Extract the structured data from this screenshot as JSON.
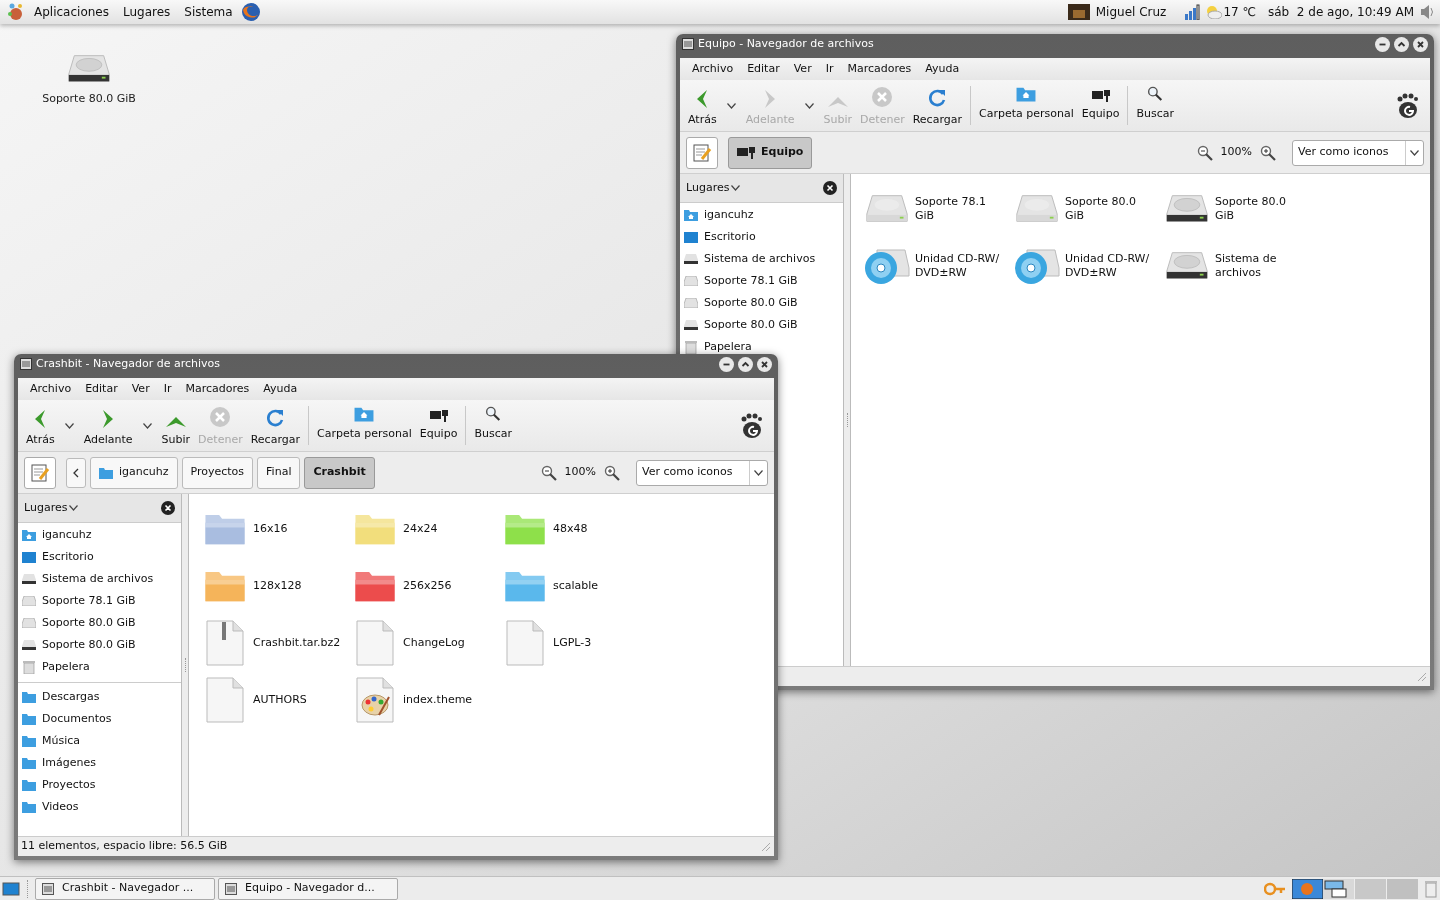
{
  "top_panel": {
    "menus": [
      "Aplicaciones",
      "Lugares",
      "Sistema"
    ],
    "user": "Miguel Cruz",
    "weather": "17 ℃",
    "clock": "sáb  2 de ago, 10:49 AM"
  },
  "desktop_icons": [
    {
      "label": "Soporte 80.0 GiB",
      "kind": "drive-dark"
    }
  ],
  "windows": [
    {
      "title": "Equipo - Navegador de archivos",
      "menus": [
        "Archivo",
        "Editar",
        "Ver",
        "Ir",
        "Marcadores",
        "Ayuda"
      ],
      "toolbar": [
        [
          {
            "label": "Atrás",
            "kind": "back",
            "disabled": false,
            "menu": true
          },
          {
            "label": "Adelante",
            "kind": "forward",
            "disabled": true,
            "menu": true
          },
          {
            "label": "Subir",
            "kind": "up",
            "disabled": true,
            "menu": false
          },
          {
            "label": "Detener",
            "kind": "stop",
            "disabled": true,
            "menu": false
          },
          {
            "label": "Recargar",
            "kind": "reload",
            "disabled": false,
            "menu": false
          }
        ],
        [
          {
            "label": "Carpeta personal",
            "kind": "home",
            "disabled": false,
            "menu": false
          },
          {
            "label": "Equipo",
            "kind": "computer",
            "disabled": false,
            "menu": false
          }
        ],
        [
          {
            "label": "Buscar",
            "kind": "search",
            "disabled": false,
            "menu": false
          }
        ]
      ],
      "location": {
        "scroll_button": false,
        "path": [
          {
            "label": "Equipo",
            "kind": "computer",
            "selected": true
          }
        ]
      },
      "zoom": "100%",
      "view": "Ver como iconos",
      "sidebar": {
        "title": "Lugares",
        "groups": [
          [
            {
              "label": "igancuhz",
              "kind": "home"
            },
            {
              "label": "Escritorio",
              "kind": "desktop"
            },
            {
              "label": "Sistema de archivos",
              "kind": "drive-dark"
            },
            {
              "label": "Soporte 78.1 GiB",
              "kind": "drive"
            },
            {
              "label": "Soporte 80.0 GiB",
              "kind": "drive"
            },
            {
              "label": "Soporte 80.0 GiB",
              "kind": "drive-dark"
            },
            {
              "label": "Papelera",
              "kind": "trash"
            }
          ]
        ]
      },
      "items": [
        {
          "label": "Soporte 78.1 GiB",
          "kind": "drive"
        },
        {
          "label": "Soporte 80.0 GiB",
          "kind": "drive"
        },
        {
          "label": "Soporte 80.0 GiB",
          "kind": "drive-dark"
        },
        {
          "label": "Unidad CD-RW/DVD±RW",
          "kind": "optical"
        },
        {
          "label": "Unidad CD-RW/DVD±RW",
          "kind": "optical"
        },
        {
          "label": "Sistema de archivos",
          "kind": "drive-dark"
        }
      ]
    },
    {
      "title": "Crashbit - Navegador de archivos",
      "menus": [
        "Archivo",
        "Editar",
        "Ver",
        "Ir",
        "Marcadores",
        "Ayuda"
      ],
      "toolbar": [
        [
          {
            "label": "Atrás",
            "kind": "back",
            "disabled": false,
            "menu": true
          },
          {
            "label": "Adelante",
            "kind": "forward",
            "disabled": false,
            "menu": true
          },
          {
            "label": "Subir",
            "kind": "up",
            "disabled": false,
            "menu": false
          },
          {
            "label": "Detener",
            "kind": "stop",
            "disabled": true,
            "menu": false
          },
          {
            "label": "Recargar",
            "kind": "reload",
            "disabled": false,
            "menu": false
          }
        ],
        [
          {
            "label": "Carpeta personal",
            "kind": "home",
            "disabled": false,
            "menu": false
          },
          {
            "label": "Equipo",
            "kind": "computer",
            "disabled": false,
            "menu": false
          }
        ],
        [
          {
            "label": "Buscar",
            "kind": "search",
            "disabled": false,
            "menu": false
          }
        ]
      ],
      "location": {
        "scroll_button": true,
        "path": [
          {
            "label": "igancuhz",
            "kind": "folder",
            "selected": false
          },
          {
            "label": "Proyectos",
            "kind": "text",
            "selected": false
          },
          {
            "label": "Final",
            "kind": "text",
            "selected": false
          },
          {
            "label": "Crashbit",
            "kind": "text",
            "selected": true
          }
        ]
      },
      "zoom": "100%",
      "view": "Ver como iconos",
      "sidebar": {
        "title": "Lugares",
        "groups": [
          [
            {
              "label": "igancuhz",
              "kind": "home"
            },
            {
              "label": "Escritorio",
              "kind": "desktop"
            },
            {
              "label": "Sistema de archivos",
              "kind": "drive-dark"
            },
            {
              "label": "Soporte 78.1 GiB",
              "kind": "drive"
            },
            {
              "label": "Soporte 80.0 GiB",
              "kind": "drive"
            },
            {
              "label": "Soporte 80.0 GiB",
              "kind": "drive-dark"
            },
            {
              "label": "Papelera",
              "kind": "trash"
            }
          ],
          [
            {
              "label": "Descargas",
              "kind": "folder"
            },
            {
              "label": "Documentos",
              "kind": "folder"
            },
            {
              "label": "Música",
              "kind": "folder"
            },
            {
              "label": "Imágenes",
              "kind": "folder"
            },
            {
              "label": "Proyectos",
              "kind": "folder"
            },
            {
              "label": "Videos",
              "kind": "folder"
            }
          ]
        ]
      },
      "items": [
        {
          "label": "16x16",
          "kind": "folder",
          "color": "#a9bde0"
        },
        {
          "label": "24x24",
          "kind": "folder",
          "color": "#f2de7c"
        },
        {
          "label": "48x48",
          "kind": "folder",
          "color": "#8ee04a"
        },
        {
          "label": "128x128",
          "kind": "folder",
          "color": "#f5b45a"
        },
        {
          "label": "256x256",
          "kind": "folder",
          "color": "#ec4c4c"
        },
        {
          "label": "scalable",
          "kind": "folder",
          "color": "#5ab8ec"
        },
        {
          "label": "Crashbit.tar.bz2",
          "kind": "archive"
        },
        {
          "label": "ChangeLog",
          "kind": "file"
        },
        {
          "label": "LGPL-3",
          "kind": "file"
        },
        {
          "label": "AUTHORS",
          "kind": "file"
        },
        {
          "label": "index.theme",
          "kind": "theme"
        }
      ],
      "status": "11 elementos, espacio libre: 56.5 GiB"
    }
  ],
  "taskbar": [
    {
      "label": "Crashbit - Navegador ..."
    },
    {
      "label": "Equipo - Navegador d..."
    }
  ]
}
